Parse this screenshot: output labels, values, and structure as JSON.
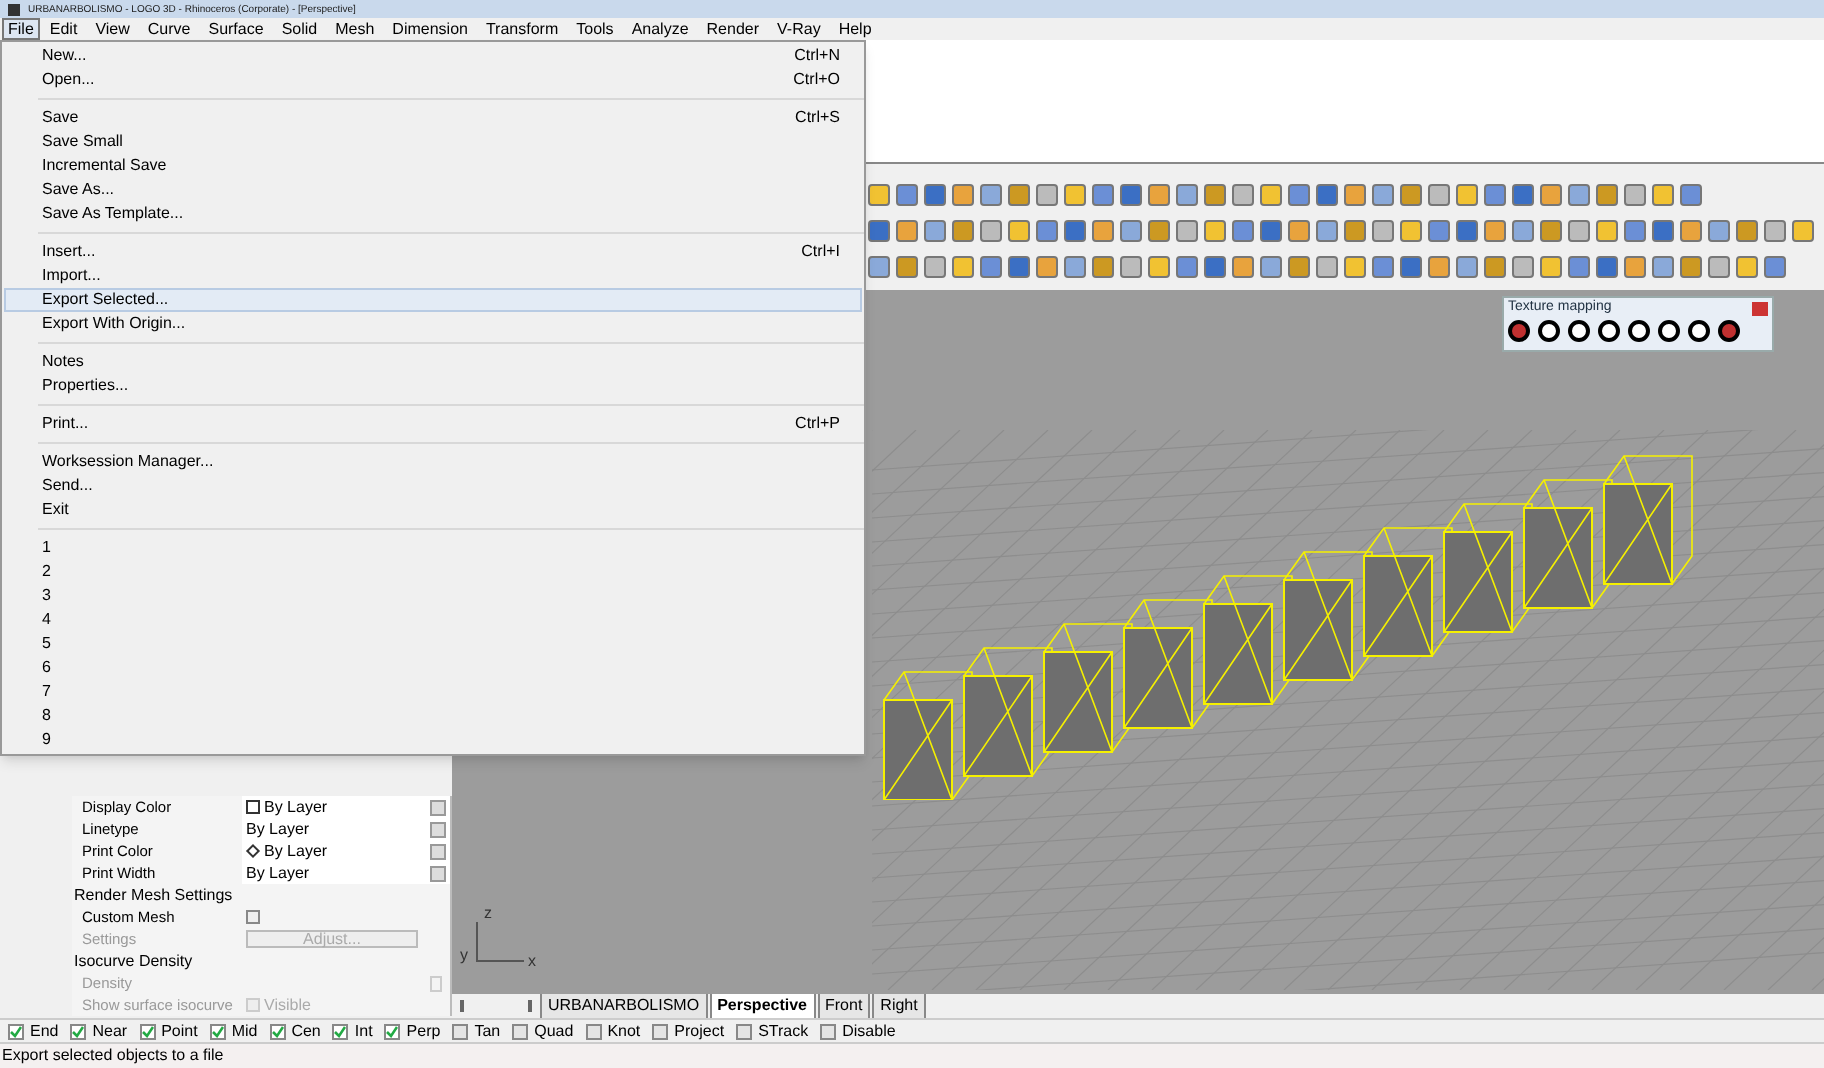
{
  "window": {
    "title": "URBANARBOLISMO - LOGO 3D - Rhinoceros (Corporate) - [Perspective]"
  },
  "menu_bar": [
    {
      "label": "File",
      "selected": true
    },
    {
      "label": "Edit",
      "selected": false
    },
    {
      "label": "View",
      "selected": false
    },
    {
      "label": "Curve",
      "selected": false
    },
    {
      "label": "Surface",
      "selected": false
    },
    {
      "label": "Solid",
      "selected": false
    },
    {
      "label": "Mesh",
      "selected": false
    },
    {
      "label": "Dimension",
      "selected": false
    },
    {
      "label": "Transform",
      "selected": false
    },
    {
      "label": "Tools",
      "selected": false
    },
    {
      "label": "Analyze",
      "selected": false
    },
    {
      "label": "Render",
      "selected": false
    },
    {
      "label": "V-Ray",
      "selected": false
    },
    {
      "label": "Help",
      "selected": false
    }
  ],
  "file_menu": {
    "groups": [
      [
        {
          "label": "New...",
          "shortcut": "Ctrl+N",
          "selected": false
        },
        {
          "label": "Open...",
          "shortcut": "Ctrl+O",
          "selected": false
        }
      ],
      [
        {
          "label": "Save",
          "shortcut": "Ctrl+S",
          "selected": false
        },
        {
          "label": "Save Small",
          "selected": false
        },
        {
          "label": "Incremental Save",
          "selected": false
        },
        {
          "label": "Save As...",
          "selected": false
        },
        {
          "label": "Save As Template...",
          "selected": false
        }
      ],
      [
        {
          "label": "Insert...",
          "shortcut": "Ctrl+I",
          "selected": false
        },
        {
          "label": "Import...",
          "selected": false
        },
        {
          "label": "Export Selected...",
          "selected": true
        },
        {
          "label": "Export With Origin...",
          "selected": false
        }
      ],
      [
        {
          "label": "Notes",
          "selected": false
        },
        {
          "label": "Properties...",
          "selected": false
        }
      ],
      [
        {
          "label": "Print...",
          "shortcut": "Ctrl+P",
          "selected": false
        }
      ],
      [
        {
          "label": "Worksession Manager...",
          "selected": false
        },
        {
          "label": "Send...",
          "selected": false
        },
        {
          "label": "Exit",
          "selected": false
        }
      ],
      [
        {
          "label": "1",
          "selected": false
        },
        {
          "label": "2",
          "selected": false
        },
        {
          "label": "3",
          "selected": false
        },
        {
          "label": "4",
          "selected": false
        },
        {
          "label": "5",
          "selected": false
        },
        {
          "label": "6",
          "selected": false
        },
        {
          "label": "7",
          "selected": false
        },
        {
          "label": "8",
          "selected": false
        },
        {
          "label": "9",
          "selected": false
        }
      ]
    ]
  },
  "texture_mapping": {
    "title": "Texture mapping"
  },
  "viewport": {
    "axis_labels": [
      "z",
      "y",
      "x"
    ]
  },
  "properties": {
    "rows": [
      {
        "kind": "color",
        "label": "Display Color",
        "value": "By Layer",
        "disabled": false
      },
      {
        "kind": "dropdown",
        "label": "Linetype",
        "value": "By Layer",
        "disabled": false
      },
      {
        "kind": "printcolor",
        "label": "Print Color",
        "value": "By Layer",
        "disabled": false
      },
      {
        "kind": "dropdown",
        "label": "Print Width",
        "value": "By Layer",
        "disabled": false
      },
      {
        "kind": "section",
        "label": "Render Mesh Settings"
      },
      {
        "kind": "checkbox",
        "label": "Custom Mesh",
        "checked": false,
        "disabled": false
      },
      {
        "kind": "button",
        "label": "Settings",
        "value": "Adjust...",
        "disabled": true
      },
      {
        "kind": "section",
        "label": "Isocurve Density"
      },
      {
        "kind": "spinner",
        "label": "Density",
        "disabled": true
      },
      {
        "kind": "checkbox",
        "label": "Show surface isocurve",
        "value": "Visible",
        "checked": false,
        "disabled": true
      }
    ]
  },
  "viewport_tabs": [
    {
      "label": "URBANARBOLISMO",
      "selected": false
    },
    {
      "label": "Perspective",
      "selected": true
    },
    {
      "label": "Front",
      "selected": false
    },
    {
      "label": "Right",
      "selected": false
    }
  ],
  "osnaps": [
    {
      "label": "End",
      "checked": true
    },
    {
      "label": "Near",
      "checked": true
    },
    {
      "label": "Point",
      "checked": true
    },
    {
      "label": "Mid",
      "checked": true
    },
    {
      "label": "Cen",
      "checked": true
    },
    {
      "label": "Int",
      "checked": true
    },
    {
      "label": "Perp",
      "checked": true
    },
    {
      "label": "Tan",
      "checked": false
    },
    {
      "label": "Quad",
      "checked": false
    },
    {
      "label": "Knot",
      "checked": false
    },
    {
      "label": "Project",
      "checked": false
    },
    {
      "label": "STrack",
      "checked": false
    },
    {
      "label": "Disable",
      "checked": false
    }
  ],
  "status_bar": {
    "text": "Export selected objects to a file"
  }
}
